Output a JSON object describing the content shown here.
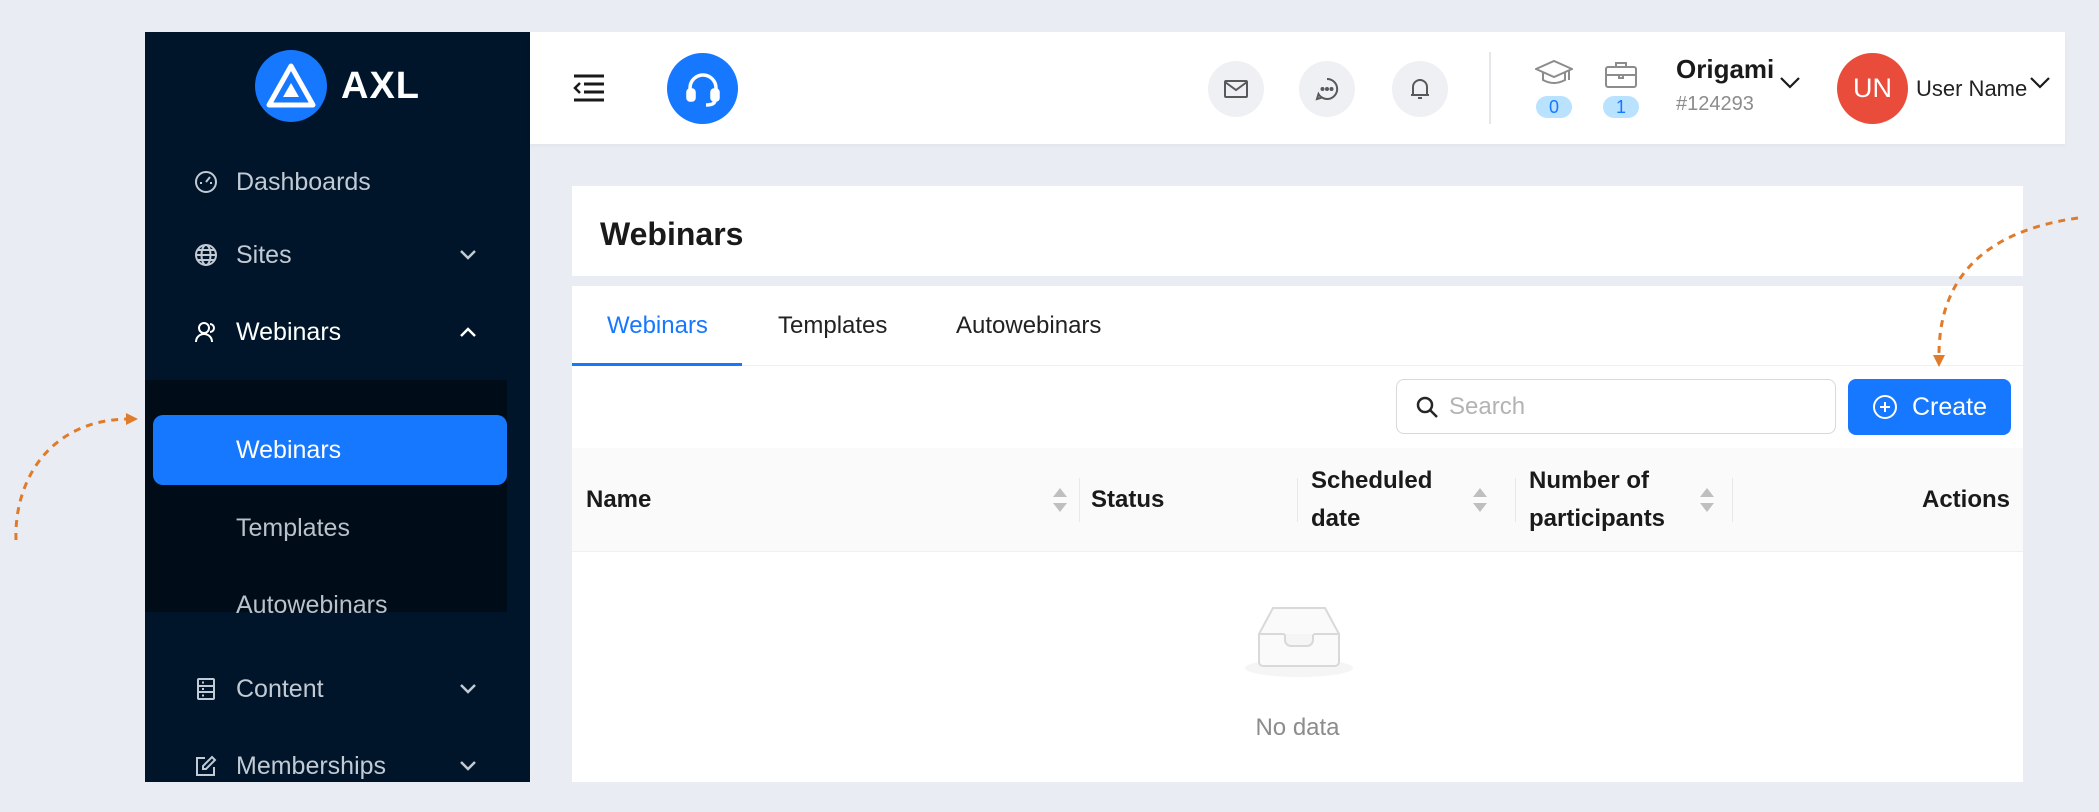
{
  "app": {
    "logo_text": "AXL"
  },
  "colors": {
    "brand": "#1677ff",
    "sidebar": "#001529",
    "avatar": "#ea4c3c",
    "annotation": "#e07b2a"
  },
  "sidebar": {
    "items": [
      {
        "label": "Dashboards",
        "icon": "dashboard-icon"
      },
      {
        "label": "Sites",
        "icon": "globe-icon"
      },
      {
        "label": "Webinars",
        "icon": "users-icon"
      },
      {
        "label": "Content",
        "icon": "content-icon"
      },
      {
        "label": "Memberships",
        "icon": "edit-icon"
      }
    ],
    "submenu": [
      {
        "label": "Webinars"
      },
      {
        "label": "Templates"
      },
      {
        "label": "Autowebinars"
      }
    ]
  },
  "header": {
    "courses_count": "0",
    "jobs_count": "1",
    "org_name": "Origami",
    "org_id": "#124293",
    "avatar_initials": "UN",
    "user_name": "User Name"
  },
  "page": {
    "title": "Webinars",
    "tabs": [
      {
        "label": "Webinars"
      },
      {
        "label": "Templates"
      },
      {
        "label": "Autowebinars"
      }
    ],
    "search_placeholder": "Search",
    "create_label": "Create",
    "table": {
      "columns": [
        {
          "label": "Name"
        },
        {
          "label": "Status"
        },
        {
          "label": "Scheduled date"
        },
        {
          "label": "Number of participants"
        },
        {
          "label": "Actions"
        }
      ],
      "empty_text": "No data"
    }
  }
}
